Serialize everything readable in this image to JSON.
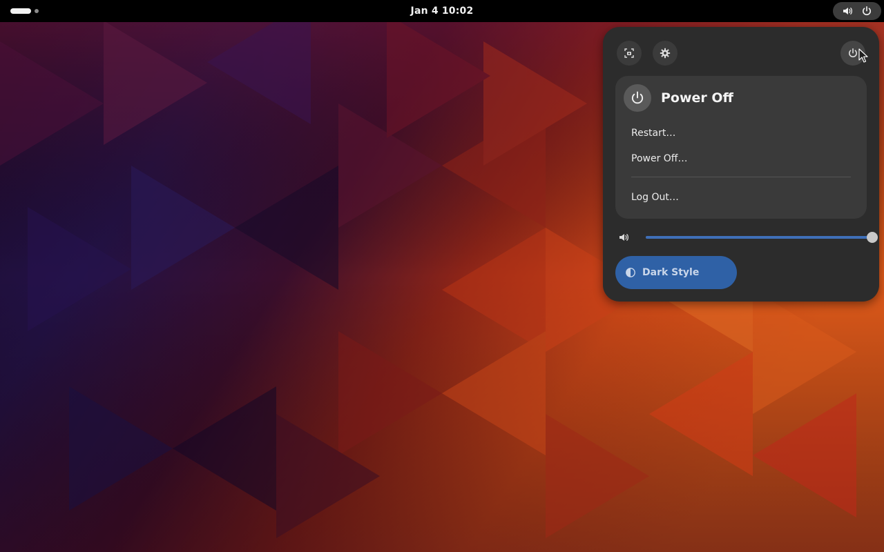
{
  "topbar": {
    "clock": "Jan 4  10:02"
  },
  "status_area": {
    "icons": [
      "volume-icon",
      "power-icon"
    ]
  },
  "quick_settings": {
    "buttons": [
      "screenshot-icon",
      "gear-icon",
      "power-icon"
    ],
    "power_menu": {
      "title": "Power Off",
      "items": [
        {
          "label": "Restart…"
        },
        {
          "label": "Power Off…"
        },
        {
          "label": "Log Out…"
        }
      ]
    },
    "volume": {
      "level": 1.0,
      "icon": "volume-icon"
    },
    "toggles": [
      {
        "label": "Dark Style",
        "icon": "dark-style-icon",
        "active": true
      }
    ]
  },
  "colors": {
    "accent": "#3f6fb8",
    "panel_bg": "#2c2c2c",
    "toggle_on": "#2f61a6",
    "topbar_bg": "#000000"
  }
}
